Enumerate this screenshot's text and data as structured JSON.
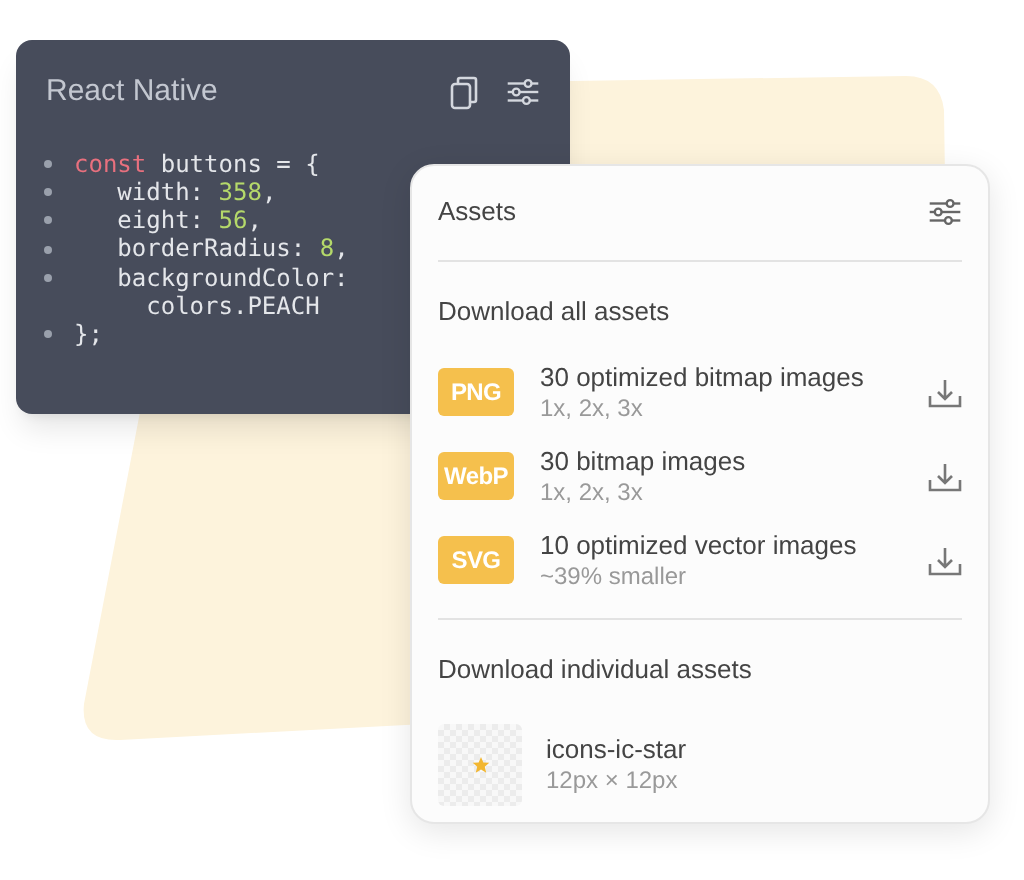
{
  "code_card": {
    "title": "React Native",
    "lines": [
      {
        "bullet": true,
        "tokens": [
          {
            "text": "const",
            "kind": "keyword"
          },
          {
            "text": " buttons = {",
            "kind": "plain"
          }
        ]
      },
      {
        "bullet": true,
        "tokens": [
          {
            "text": "   width: ",
            "kind": "plain"
          },
          {
            "text": "358",
            "kind": "number"
          },
          {
            "text": ",",
            "kind": "plain"
          }
        ]
      },
      {
        "bullet": true,
        "tokens": [
          {
            "text": "   eight: ",
            "kind": "plain"
          },
          {
            "text": "56",
            "kind": "number"
          },
          {
            "text": ",",
            "kind": "plain"
          }
        ]
      },
      {
        "bullet": true,
        "tokens": [
          {
            "text": "   borderRadius: ",
            "kind": "plain"
          },
          {
            "text": "8",
            "kind": "number"
          },
          {
            "text": ",",
            "kind": "plain"
          }
        ]
      },
      {
        "bullet": true,
        "tokens": [
          {
            "text": "   backgroundColor:",
            "kind": "plain"
          }
        ]
      },
      {
        "bullet": false,
        "tokens": [
          {
            "text": "     colors.PEACH",
            "kind": "plain"
          }
        ]
      },
      {
        "bullet": true,
        "tokens": [
          {
            "text": "};",
            "kind": "plain"
          }
        ]
      }
    ]
  },
  "assets_panel": {
    "title": "Assets",
    "all_heading": "Download all assets",
    "downloads": [
      {
        "badge": "PNG",
        "title": "30 optimized bitmap images",
        "subtitle": "1x, 2x, 3x"
      },
      {
        "badge": "WebP",
        "title": "30 bitmap images",
        "subtitle": "1x, 2x, 3x"
      },
      {
        "badge": "SVG",
        "title": "10 optimized vector images",
        "subtitle": "~39% smaller"
      }
    ],
    "individual_heading": "Download individual assets",
    "individual": [
      {
        "name": "icons-ic-star",
        "size": "12px × 12px"
      }
    ]
  }
}
